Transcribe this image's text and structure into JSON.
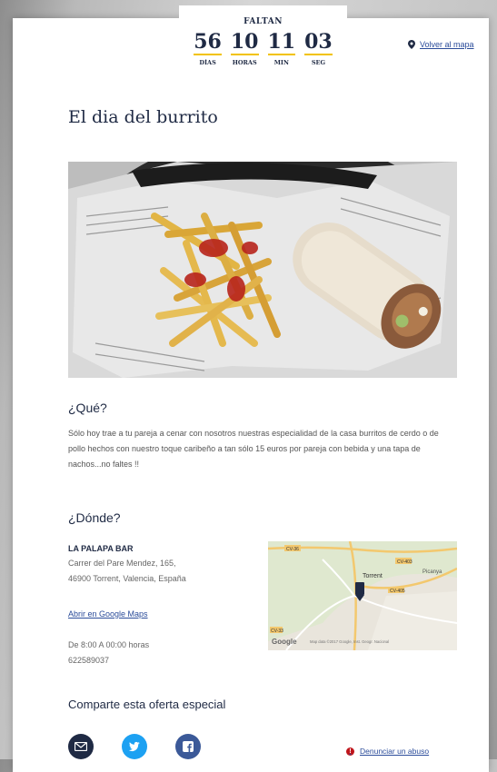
{
  "countdown": {
    "title": "FALTAN",
    "days": "56",
    "days_label": "DÍAS",
    "hours": "10",
    "hours_label": "HORAS",
    "minutes": "11",
    "minutes_label": "MIN",
    "seconds": "03",
    "seconds_label": "SEG"
  },
  "nav": {
    "back_label": "Volver al mapa"
  },
  "event": {
    "title": "El dia del burrito"
  },
  "what": {
    "heading": "¿Qué?",
    "description": "Sólo hoy trae a tu pareja a cenar con nosotros nuestras especialidad de la casa burritos de cerdo o de pollo hechos con nuestro toque caribeño a tan sólo 15 euros por pareja con bebida y una tapa de nachos...no faltes !!"
  },
  "where": {
    "heading": "¿Dónde?",
    "venue": "LA PALAPA BAR",
    "address_line1": "Carrer del Pare Mendez, 165,",
    "address_line2": "46900 Torrent, Valencia, España",
    "maps_link": "Abrir en Google Maps",
    "hours": "De 8:00 A 00:00 horas",
    "phone": "622589037"
  },
  "map": {
    "city_label": "Torrent",
    "suburb_label": "Picanya",
    "google_logo": "Google",
    "attribution": "Map data ©2017 Google, Inst. Geogr. Nacional",
    "road_labels": [
      "CV-36",
      "CV-403",
      "CV-405",
      "CV-33",
      "CV-405"
    ]
  },
  "share": {
    "heading": "Comparte esta oferta especial"
  },
  "report": {
    "label": "Denunciar un abuso"
  },
  "colors": {
    "navy": "#1f2a44",
    "accent_yellow": "#f2c200",
    "link_blue": "#2b4c9a",
    "twitter": "#1da1f2",
    "facebook": "#3b5998",
    "report_red": "#c0151b"
  }
}
